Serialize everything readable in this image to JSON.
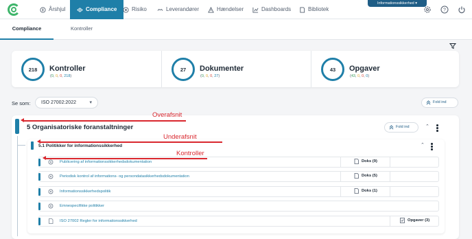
{
  "nav": {
    "items": [
      {
        "label": "Årshjul",
        "icon": "compass-icon"
      },
      {
        "label": "Compliance",
        "icon": "compliance-icon",
        "active": true
      },
      {
        "label": "Risiko",
        "icon": "risk-icon"
      },
      {
        "label": "Leverandører",
        "icon": "suppliers-icon"
      },
      {
        "label": "Hændelser",
        "icon": "warning-icon"
      },
      {
        "label": "Dashboards",
        "icon": "chart-icon"
      },
      {
        "label": "Bibliotek",
        "icon": "document-icon"
      }
    ],
    "context_badge": "Informationssikkerhed",
    "right_icons": [
      "gear-icon",
      "help-icon",
      "power-icon"
    ]
  },
  "subtabs": [
    {
      "label": "Compliance",
      "active": true
    },
    {
      "label": "Kontroller",
      "active": false
    }
  ],
  "stats": [
    {
      "value": "218",
      "title": "Kontroller",
      "sub": [
        "0",
        "0",
        "0",
        "218"
      ]
    },
    {
      "value": "27",
      "title": "Dokumenter",
      "sub": [
        "0",
        "0",
        "0",
        "27"
      ]
    },
    {
      "value": "43",
      "title": "Opgaver",
      "sub": [
        "43",
        "0",
        "0",
        "0"
      ]
    }
  ],
  "filter": {
    "label": "Se som:",
    "selected": "ISO 27002:2022"
  },
  "fold_all_label": "Fold ind",
  "section": {
    "title": "5 Organisatoriske foranstaltninger",
    "fold_label": "Fold ind",
    "subsection": {
      "title": "5.1 Politikker for informationssikkerhed",
      "rows": [
        {
          "label": "Publicering af informationssikkerhedsdokumentation",
          "count": "Doks (9)",
          "count_icon": "document-icon",
          "icon": "control-icon"
        },
        {
          "label": "Periodisk kontrol af informations- og persondatasikkerhedsdokumentation",
          "count": "Doks (5)",
          "count_icon": "document-icon",
          "icon": "control-icon"
        },
        {
          "label": "Informationssikkerhedspolitik",
          "count": "Doks (1)",
          "count_icon": "document-icon",
          "icon": "control-icon"
        },
        {
          "label": "Emnespecifikke politikker",
          "count": "",
          "icon": "control-icon"
        },
        {
          "label": "ISO 27002 Regler for informationssikkerhed",
          "count": "Opgaver (3)",
          "count_icon": "task-icon",
          "icon": "document-icon"
        }
      ]
    }
  },
  "annotations": {
    "overafsnit": "Overafsnit",
    "underafsnit": "Underafsnit",
    "kontroller": "Kontroller"
  },
  "colors": {
    "accent": "#1f7fa8",
    "annotation": "#d9262d",
    "green": "#3a9b5c",
    "amber": "#e0a82e",
    "red": "#d64a3b"
  }
}
